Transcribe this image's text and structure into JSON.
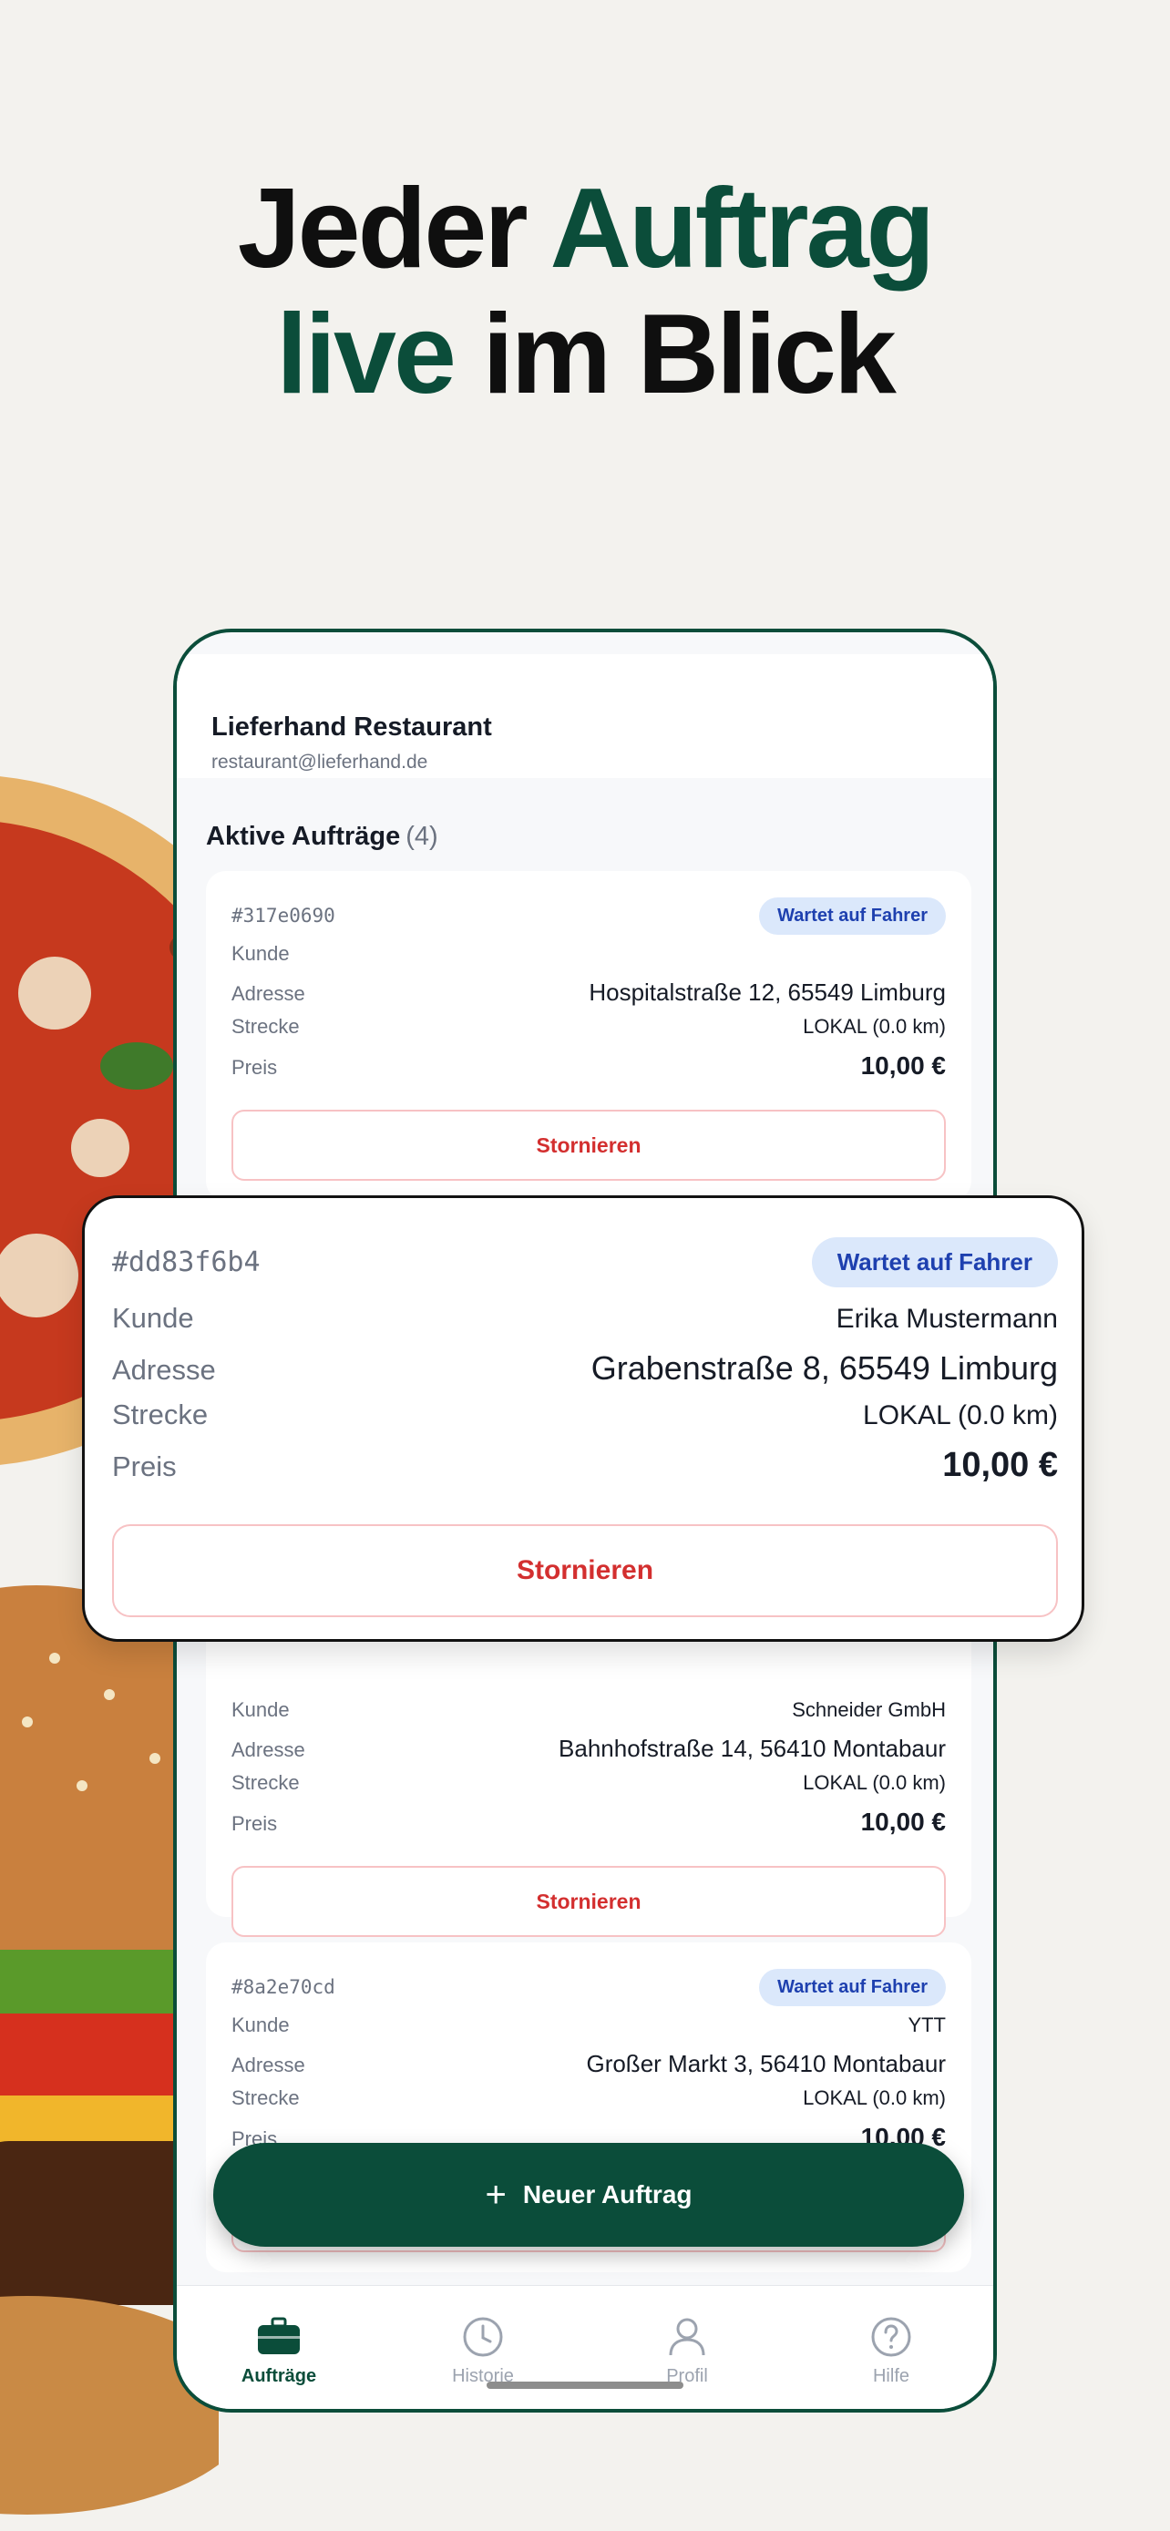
{
  "headline": {
    "line1_plain": "Jeder",
    "line1_accent": "Auftrag",
    "line2_accent": "live",
    "line2_plain": "im Blick"
  },
  "colors": {
    "brand_green": "#0b4d3a",
    "badge_bg": "#dbe8fb",
    "badge_text": "#1e40af",
    "cancel_red": "#d32f2f",
    "background": "#f3f2ee"
  },
  "app": {
    "name": "Lieferhand Restaurant",
    "email": "restaurant@lieferhand.de"
  },
  "orders_section": {
    "title": "Aktive Aufträge",
    "count": "(4)"
  },
  "labels": {
    "customer": "Kunde",
    "address": "Adresse",
    "route": "Strecke",
    "price": "Preis",
    "cancel": "Stornieren"
  },
  "orders": [
    {
      "id": "#317e0690",
      "status": "Wartet auf Fahrer",
      "customer": "",
      "address": "Hospitalstraße 12, 65549 Limburg",
      "route": "LOKAL (0.0 km)",
      "price": "10,00 €"
    },
    {
      "id": "#dd83f6b4",
      "status": "Wartet auf Fahrer",
      "customer": "Erika Mustermann",
      "address": "Grabenstraße 8, 65549 Limburg",
      "route": "LOKAL (0.0 km)",
      "price": "10,00 €"
    },
    {
      "id": "",
      "status": "",
      "customer": "Schneider GmbH",
      "address": "Bahnhofstraße 14, 56410 Montabaur",
      "route": "LOKAL (0.0 km)",
      "price": "10,00 €"
    },
    {
      "id": "#8a2e70cd",
      "status": "Wartet auf Fahrer",
      "customer": "YTT",
      "address": "Großer Markt 3, 56410 Montabaur",
      "route": "LOKAL (0.0 km)",
      "price": "10,00 €"
    }
  ],
  "fab": {
    "icon": "plus-icon",
    "label": "Neuer Auftrag"
  },
  "tabbar": [
    {
      "label": "Aufträge",
      "icon": "briefcase-icon",
      "active": true
    },
    {
      "label": "Historie",
      "icon": "clock-icon",
      "active": false
    },
    {
      "label": "Profil",
      "icon": "person-icon",
      "active": false
    },
    {
      "label": "Hilfe",
      "icon": "help-icon",
      "active": false
    }
  ]
}
